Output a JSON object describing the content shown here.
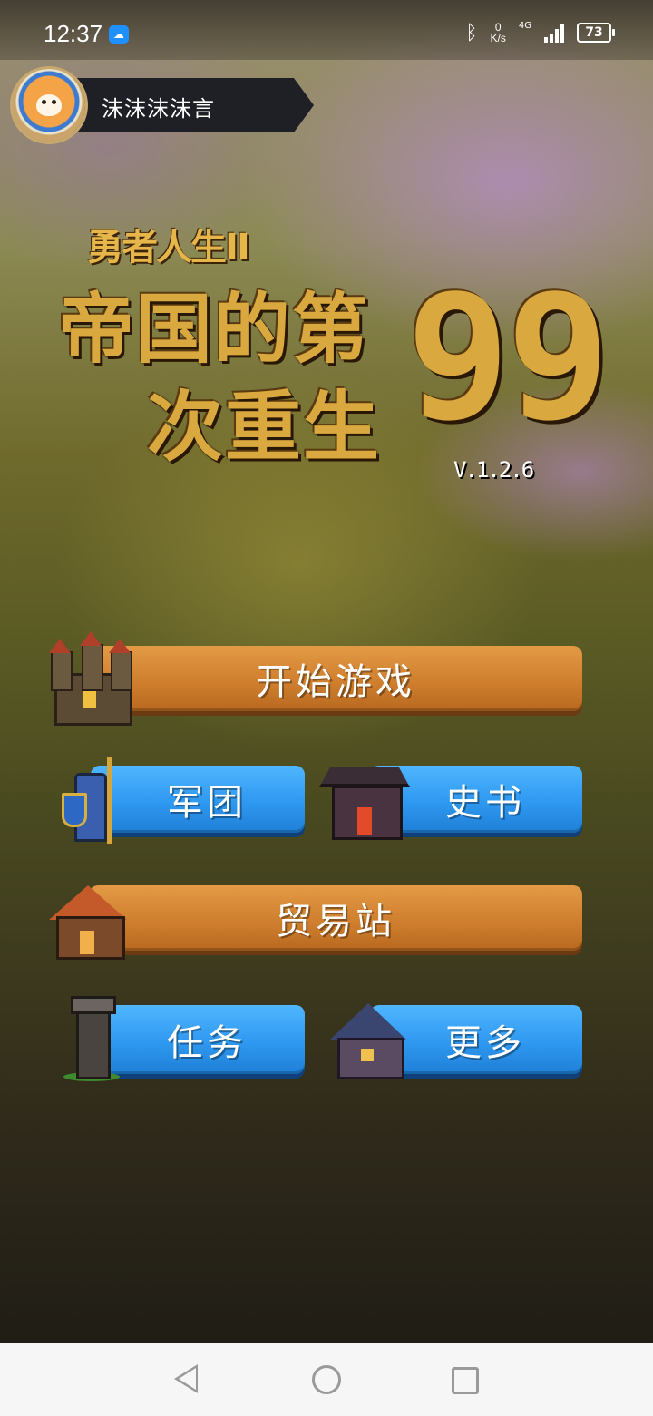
{
  "status_bar": {
    "time": "12:37",
    "net_speed_value": "0",
    "net_speed_unit": "K/s",
    "network_type": "4G",
    "battery": "73"
  },
  "profile": {
    "name": "沫沫沫沫言"
  },
  "title": {
    "subtitle": "勇者人生II",
    "line1": "帝国的第",
    "line2": "次重生",
    "number": "99",
    "version": "V.1.2.6"
  },
  "menu": {
    "start": "开始游戏",
    "legion": "军团",
    "history": "史书",
    "trade": "贸易站",
    "quest": "任务",
    "more": "更多"
  },
  "colors": {
    "orange_button": "#cf7f2e",
    "blue_button": "#2f98f0",
    "title_gold": "#d9a83e"
  }
}
